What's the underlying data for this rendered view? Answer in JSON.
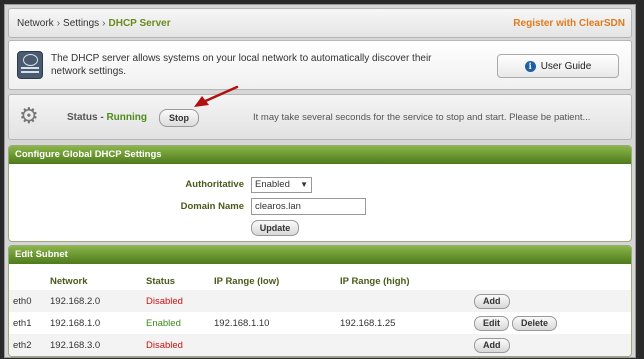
{
  "breadcrumb": {
    "items": [
      "Network",
      "Settings"
    ],
    "current": "DHCP Server"
  },
  "register_link": "Register with ClearSDN",
  "info": {
    "text": "The DHCP server allows systems on your local network to automatically discover their network settings.",
    "guide_label": "User Guide",
    "icon": "server-globe-icon"
  },
  "status": {
    "label": "Status",
    "dash": " - ",
    "value": "Running",
    "stop_label": "Stop",
    "message": "It may take several seconds for the service to stop and start.  Please be patient..."
  },
  "global": {
    "title": "Configure Global DHCP Settings",
    "authoritative_label": "Authoritative",
    "authoritative_value": "Enabled",
    "domain_label": "Domain Name",
    "domain_value": "clearos.lan",
    "update_label": "Update"
  },
  "subnet": {
    "title": "Edit Subnet",
    "columns": [
      "",
      "Network",
      "Status",
      "IP Range (low)",
      "IP Range (high)",
      ""
    ],
    "rows": [
      {
        "iface": "eth0",
        "network": "192.168.2.0",
        "status": "Disabled",
        "low": "",
        "high": "",
        "actions": [
          "Add"
        ]
      },
      {
        "iface": "eth1",
        "network": "192.168.1.0",
        "status": "Enabled",
        "low": "192.168.1.10",
        "high": "192.168.1.25",
        "actions": [
          "Edit",
          "Delete"
        ]
      },
      {
        "iface": "eth2",
        "network": "192.168.3.0",
        "status": "Disabled",
        "low": "",
        "high": "",
        "actions": [
          "Add"
        ]
      }
    ]
  },
  "colors": {
    "accent_green": "#4d7a1a",
    "running": "#4f8b1a",
    "disabled": "#cc1111",
    "register": "#e07b1c",
    "annotation_arrow": "#b01010"
  }
}
